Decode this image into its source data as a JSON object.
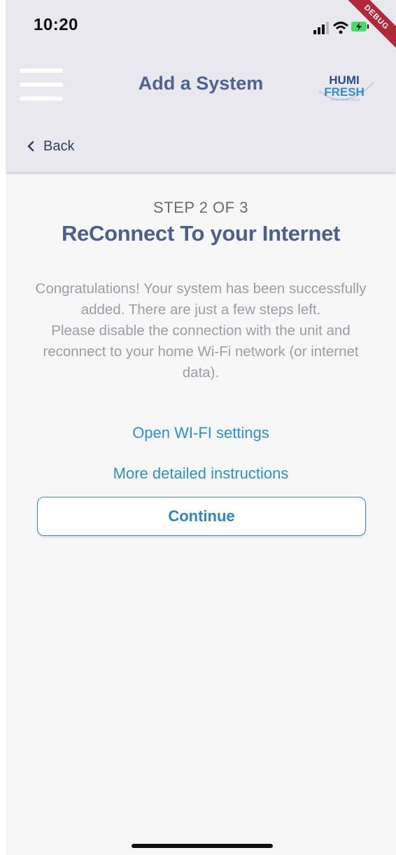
{
  "status_bar": {
    "time": "10:20"
  },
  "debug_banner": "DEBUG",
  "app_bar": {
    "title": "Add a System",
    "logo_text_top": "HUMI",
    "logo_text_bottom": "FRESH",
    "logo_subtext": "VENTILATIONS",
    "menu_icon": "hamburger-menu-icon"
  },
  "nav": {
    "back_label": "Back",
    "back_icon": "chevron-left-icon"
  },
  "step": {
    "label": "STEP 2 OF 3",
    "title": "ReConnect To your Internet"
  },
  "description": {
    "paragraph_1": "Congratulations! Your system has been successfully added. There are just a few steps left.",
    "paragraph_2": "Please disable the connection with the unit and reconnect to your home Wi-Fi network (or internet data)."
  },
  "links": {
    "wifi_settings": "Open WI-FI settings",
    "instructions": "More detailed instructions"
  },
  "actions": {
    "continue_label": "Continue"
  },
  "colors": {
    "header_bg": "#e9e8ee",
    "title_color": "#4e6390",
    "link_color": "#2f90c8",
    "debug_banner": "#b0283a"
  }
}
